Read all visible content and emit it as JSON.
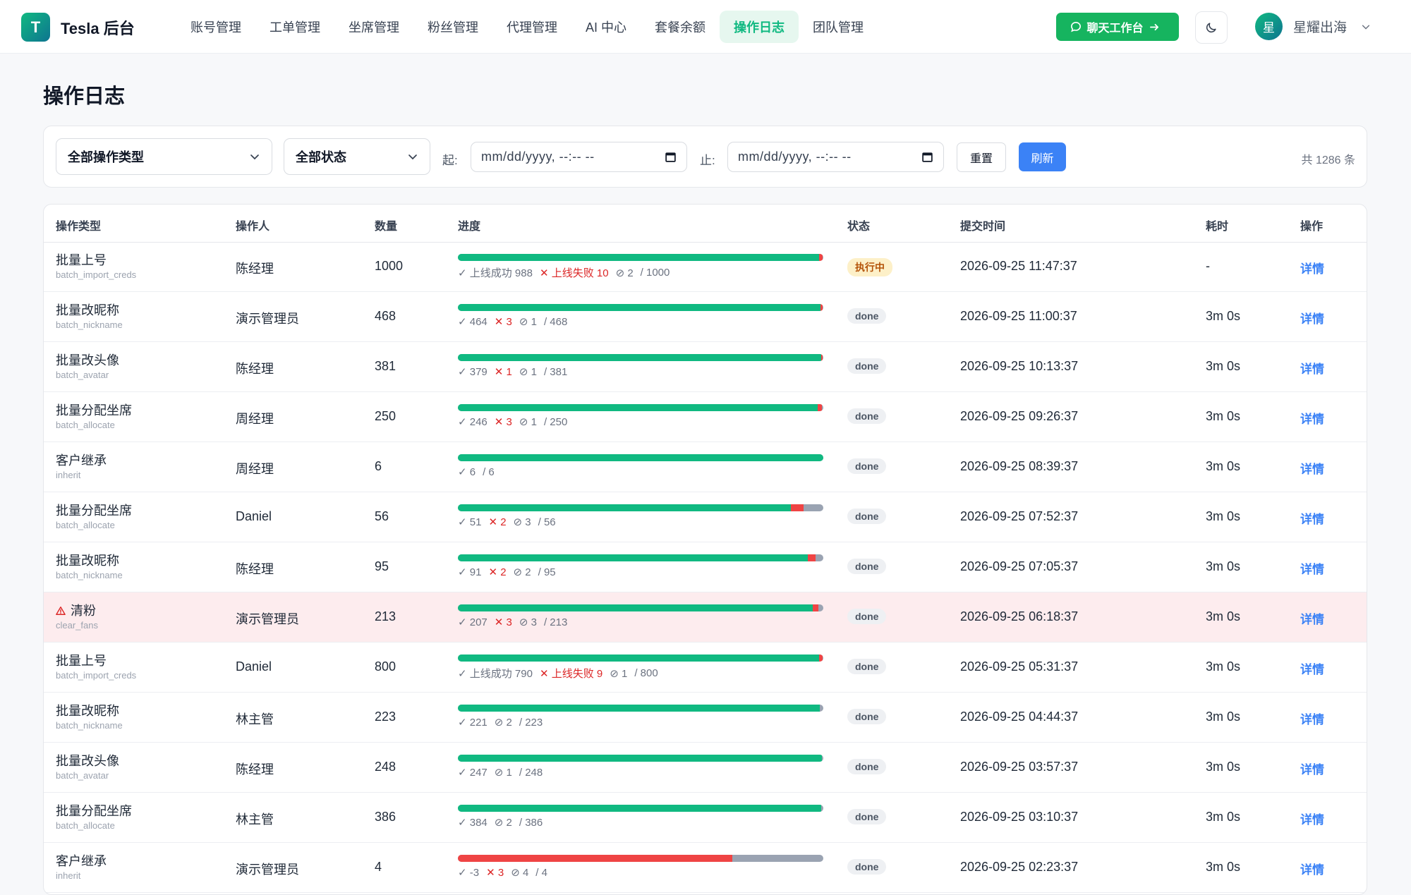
{
  "brand": {
    "logo_letter": "T",
    "name": "Tesla 后台",
    "accent": "#10b981"
  },
  "nav": {
    "items": [
      {
        "label": "账号管理"
      },
      {
        "label": "工单管理"
      },
      {
        "label": "坐席管理"
      },
      {
        "label": "粉丝管理"
      },
      {
        "label": "代理管理"
      },
      {
        "label": "AI 中心"
      },
      {
        "label": "套餐余额"
      },
      {
        "label": "操作日志",
        "active": true
      },
      {
        "label": "团队管理"
      }
    ]
  },
  "header": {
    "chat_button": "聊天工作台",
    "theme_icon": "moon-icon",
    "user": {
      "avatar_letter": "星",
      "name": "星耀出海"
    }
  },
  "page": {
    "title": "操作日志"
  },
  "filters": {
    "type_select": "全部操作类型",
    "status_select": "全部状态",
    "from_label": "起:",
    "to_label": "止:",
    "date_placeholder": "mm/dd/yyyy, --:-- --",
    "reset": "重置",
    "refresh": "刷新",
    "total": "共 1286 条"
  },
  "table": {
    "columns": [
      "操作类型",
      "操作人",
      "数量",
      "进度",
      "状态",
      "提交时间",
      "耗时",
      "操作"
    ],
    "colors": {
      "success": "#10b981",
      "fail": "#ef4444",
      "skip": "#9aa3b2",
      "link": "#3b82f6"
    },
    "rows": [
      {
        "type": "批量上号",
        "code": "batch_import_creds",
        "operator": "陈经理",
        "qty": "1000",
        "ok": 988,
        "fail": 10,
        "skip": 2,
        "total": 1000,
        "ok_label": "上线成功 988",
        "fail_label": "上线失败 10",
        "skip_label": "2",
        "total_label": "/ 1000",
        "status": "执行中",
        "running": true,
        "time": "2026-09-25 11:47:37",
        "duration": "-",
        "action": "详情"
      },
      {
        "type": "批量改昵称",
        "code": "batch_nickname",
        "operator": "演示管理员",
        "qty": "468",
        "ok": 464,
        "fail": 3,
        "skip": 1,
        "total": 468,
        "ok_label": "464",
        "fail_label": "3",
        "skip_label": "1",
        "total_label": "/ 468",
        "status": "done",
        "time": "2026-09-25 11:00:37",
        "duration": "3m 0s",
        "action": "详情"
      },
      {
        "type": "批量改头像",
        "code": "batch_avatar",
        "operator": "陈经理",
        "qty": "381",
        "ok": 379,
        "fail": 1,
        "skip": 1,
        "total": 381,
        "ok_label": "379",
        "fail_label": "1",
        "skip_label": "1",
        "total_label": "/ 381",
        "status": "done",
        "time": "2026-09-25 10:13:37",
        "duration": "3m 0s",
        "action": "详情"
      },
      {
        "type": "批量分配坐席",
        "code": "batch_allocate",
        "operator": "周经理",
        "qty": "250",
        "ok": 246,
        "fail": 3,
        "skip": 1,
        "total": 250,
        "ok_label": "246",
        "fail_label": "3",
        "skip_label": "1",
        "total_label": "/ 250",
        "status": "done",
        "time": "2026-09-25 09:26:37",
        "duration": "3m 0s",
        "action": "详情"
      },
      {
        "type": "客户继承",
        "code": "inherit",
        "operator": "周经理",
        "qty": "6",
        "ok": 6,
        "fail": 0,
        "skip": 0,
        "total": 6,
        "ok_label": "6",
        "fail_label": "",
        "skip_label": "",
        "total_label": "/ 6",
        "status": "done",
        "time": "2026-09-25 08:39:37",
        "duration": "3m 0s",
        "action": "详情"
      },
      {
        "type": "批量分配坐席",
        "code": "batch_allocate",
        "operator": "Daniel",
        "qty": "56",
        "ok": 51,
        "fail": 2,
        "skip": 3,
        "total": 56,
        "ok_label": "51",
        "fail_label": "2",
        "skip_label": "3",
        "total_label": "/ 56",
        "status": "done",
        "time": "2026-09-25 07:52:37",
        "duration": "3m 0s",
        "action": "详情"
      },
      {
        "type": "批量改昵称",
        "code": "batch_nickname",
        "operator": "陈经理",
        "qty": "95",
        "ok": 91,
        "fail": 2,
        "skip": 2,
        "total": 95,
        "ok_label": "91",
        "fail_label": "2",
        "skip_label": "2",
        "total_label": "/ 95",
        "status": "done",
        "time": "2026-09-25 07:05:37",
        "duration": "3m 0s",
        "action": "详情"
      },
      {
        "type": "清粉",
        "code": "clear_fans",
        "warning": true,
        "operator": "演示管理员",
        "qty": "213",
        "ok": 207,
        "fail": 3,
        "skip": 3,
        "total": 213,
        "ok_label": "207",
        "fail_label": "3",
        "skip_label": "3",
        "total_label": "/ 213",
        "status": "done",
        "time": "2026-09-25 06:18:37",
        "duration": "3m 0s",
        "action": "详情"
      },
      {
        "type": "批量上号",
        "code": "batch_import_creds",
        "operator": "Daniel",
        "qty": "800",
        "ok": 790,
        "fail": 9,
        "skip": 1,
        "total": 800,
        "ok_label": "上线成功 790",
        "fail_label": "上线失败 9",
        "skip_label": "1",
        "total_label": "/ 800",
        "status": "done",
        "time": "2026-09-25 05:31:37",
        "duration": "3m 0s",
        "action": "详情"
      },
      {
        "type": "批量改昵称",
        "code": "batch_nickname",
        "operator": "林主管",
        "qty": "223",
        "ok": 221,
        "fail": 0,
        "skip": 2,
        "total": 223,
        "ok_label": "221",
        "fail_label": "",
        "skip_label": "2",
        "total_label": "/ 223",
        "status": "done",
        "time": "2026-09-25 04:44:37",
        "duration": "3m 0s",
        "action": "详情"
      },
      {
        "type": "批量改头像",
        "code": "batch_avatar",
        "operator": "陈经理",
        "qty": "248",
        "ok": 247,
        "fail": 0,
        "skip": 1,
        "total": 248,
        "ok_label": "247",
        "fail_label": "",
        "skip_label": "1",
        "total_label": "/ 248",
        "status": "done",
        "time": "2026-09-25 03:57:37",
        "duration": "3m 0s",
        "action": "详情"
      },
      {
        "type": "批量分配坐席",
        "code": "batch_allocate",
        "operator": "林主管",
        "qty": "386",
        "ok": 384,
        "fail": 0,
        "skip": 2,
        "total": 386,
        "ok_label": "384",
        "fail_label": "",
        "skip_label": "2",
        "total_label": "/ 386",
        "status": "done",
        "time": "2026-09-25 03:10:37",
        "duration": "3m 0s",
        "action": "详情"
      },
      {
        "type": "客户继承",
        "code": "inherit",
        "operator": "演示管理员",
        "qty": "4",
        "ok": -3,
        "fail": 3,
        "skip": 4,
        "total": 4,
        "ok_label": "-3",
        "fail_label": "3",
        "skip_label": "4",
        "total_label": "/ 4",
        "status": "done",
        "time": "2026-09-25 02:23:37",
        "duration": "3m 0s",
        "action": "详情"
      }
    ]
  }
}
